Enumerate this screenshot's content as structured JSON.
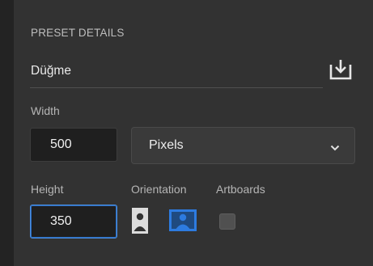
{
  "preset": {
    "section_title": "PRESET DETAILS",
    "name": "Düğme",
    "width_label": "Width",
    "width_value": "500",
    "unit_selected": "Pixels",
    "height_label": "Height",
    "height_value": "350",
    "orientation_label": "Orientation",
    "artboards_label": "Artboards",
    "artboards_checked": false,
    "orientation_selected": "landscape"
  },
  "icons": {
    "save": "save-preset-icon",
    "dropdown": "chevron-down-icon",
    "portrait": "portrait-orientation-icon",
    "landscape": "landscape-orientation-icon"
  },
  "colors": {
    "accent": "#2d7be0",
    "focus_border": "#4c8fe0"
  }
}
